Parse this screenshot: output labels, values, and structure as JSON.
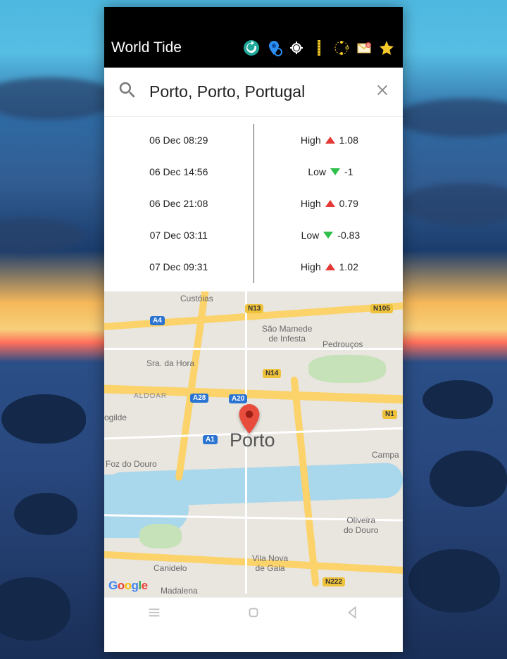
{
  "header": {
    "title": "World Tide"
  },
  "toolbar_icons": {
    "refresh": "refresh-icon",
    "location_pin": "location-pin-icon",
    "gps": "gps-target-icon",
    "ruler": "ruler-icon",
    "moon": "moon-phase-icon",
    "mail": "mail-icon",
    "star": "star-icon"
  },
  "search": {
    "value": "Porto, Porto, Portugal"
  },
  "tides": [
    {
      "time": "06 Dec 08:29",
      "label": "High",
      "dir": "up",
      "value": "1.08"
    },
    {
      "time": "06 Dec 14:56",
      "label": "Low",
      "dir": "down",
      "value": "-1"
    },
    {
      "time": "06 Dec 21:08",
      "label": "High",
      "dir": "up",
      "value": "0.79"
    },
    {
      "time": "07 Dec 03:11",
      "label": "Low",
      "dir": "down",
      "value": "-0.83"
    },
    {
      "time": "07 Dec 09:31",
      "label": "High",
      "dir": "up",
      "value": "1.02"
    }
  ],
  "map": {
    "city": "Porto",
    "attribution": "Google",
    "shields": {
      "a4": "A4",
      "a28": "A28",
      "a20": "A20",
      "a1": "A1",
      "n13": "N13",
      "n105": "N105",
      "n14": "N14",
      "n1": "N1",
      "n222": "N222"
    },
    "labels": {
      "custoias": "Custóias",
      "sao_mamede": "São Mamede\nde Infesta",
      "pedroucos": "Pedrouços",
      "sra_hora": "Sra. da Hora",
      "aldoar": "ALDOAR",
      "ogilde": "ogilde",
      "foz": "Foz do Douro",
      "campa": "Campa",
      "canidelo": "Canidelo",
      "vng": "Vila Nova\nde Gaia",
      "oliveira": "Oliveira\ndo Douro",
      "madalena": "Madalena"
    }
  },
  "navbar": {
    "recent": "recent",
    "home": "home",
    "back": "back"
  }
}
